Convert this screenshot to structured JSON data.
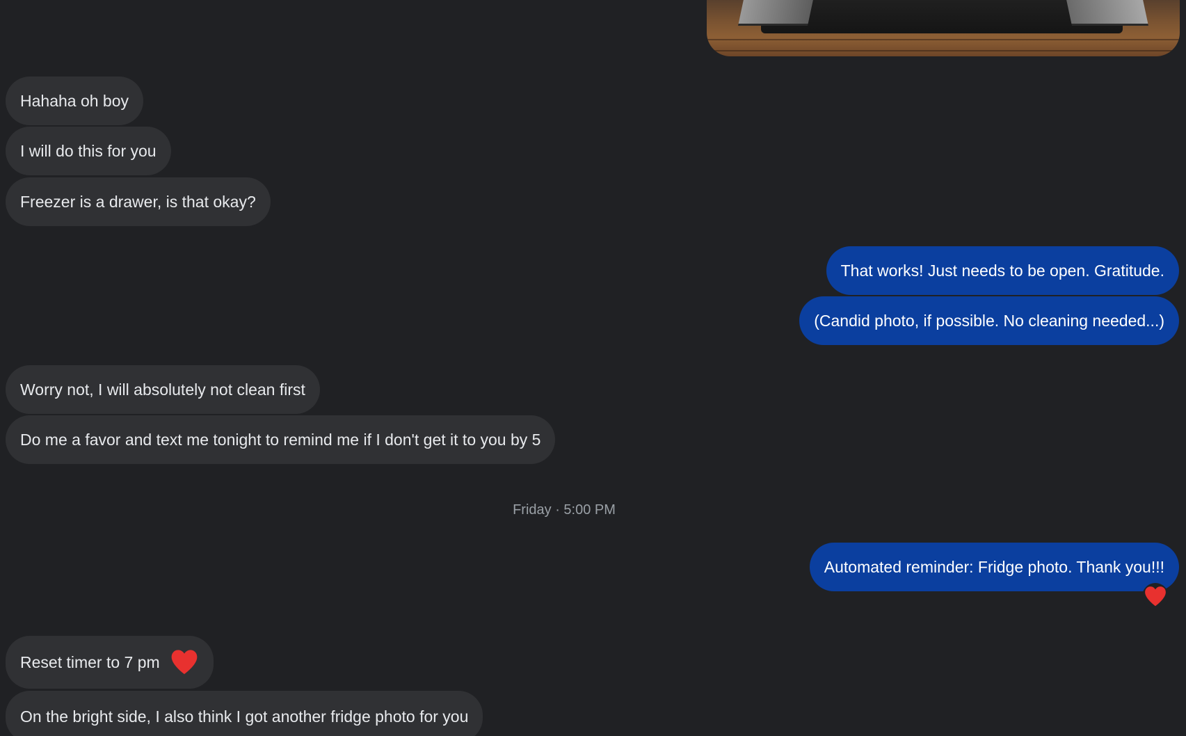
{
  "conversation": {
    "messages": [
      {
        "direction": "incoming",
        "text": "Hahaha oh boy"
      },
      {
        "direction": "incoming",
        "text": "I will do this for you"
      },
      {
        "direction": "incoming",
        "text": "Freezer is a drawer, is that okay?"
      },
      {
        "direction": "outgoing",
        "text": "That works! Just needs to be open. Gratitude."
      },
      {
        "direction": "outgoing",
        "text": "(Candid photo, if possible. No cleaning needed...)"
      },
      {
        "direction": "incoming",
        "text": "Worry not, I will absolutely not clean first"
      },
      {
        "direction": "incoming",
        "text": "Do me a favor and text me tonight to remind me if I don't get it to you by 5"
      },
      {
        "direction": "outgoing",
        "text": "Automated reminder: Fridge photo. Thank you!!!",
        "reaction": "heart"
      },
      {
        "direction": "incoming",
        "text": "Reset timer to 7 pm",
        "reaction": "heart"
      },
      {
        "direction": "incoming",
        "text": "On the bright side, I also think I got another fridge photo for you"
      }
    ],
    "timestamp": "Friday · 5:00 PM"
  },
  "colors": {
    "background": "#202124",
    "incoming_bubble": "#303134",
    "outgoing_bubble": "#0b3f9f",
    "incoming_text": "#e8eaed",
    "outgoing_text": "#ffffff",
    "timestamp_text": "#9aa0a6",
    "heart": "#e8312f"
  },
  "icons": {
    "reaction": "heart-icon"
  }
}
